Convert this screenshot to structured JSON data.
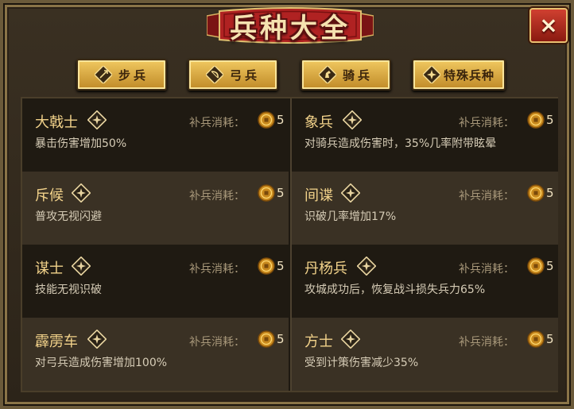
{
  "title": "兵种大全",
  "close_icon": "×",
  "tabs": [
    {
      "label": "步兵",
      "icon": "spear-icon"
    },
    {
      "label": "弓兵",
      "icon": "bow-icon"
    },
    {
      "label": "骑兵",
      "icon": "horse-icon"
    },
    {
      "label": "特殊兵种",
      "icon": "star-icon"
    }
  ],
  "cost_label": "补兵消耗：",
  "units": [
    {
      "name": "大戟士",
      "cost": "5",
      "desc": "暴击伤害增加50%"
    },
    {
      "name": "象兵",
      "cost": "5",
      "desc": "对骑兵造成伤害时，35%几率附带眩晕"
    },
    {
      "name": "斥候",
      "cost": "5",
      "desc": "普攻无视闪避"
    },
    {
      "name": "间谍",
      "cost": "5",
      "desc": "识破几率增加17%"
    },
    {
      "name": "谋士",
      "cost": "5",
      "desc": "技能无视识破"
    },
    {
      "name": "丹杨兵",
      "cost": "5",
      "desc": "攻城成功后，恢复战斗损失兵力65%"
    },
    {
      "name": "霹雳车",
      "cost": "5",
      "desc": "对弓兵造成伤害增加100%"
    },
    {
      "name": "方士",
      "cost": "5",
      "desc": "受到计策伤害减少35%"
    }
  ],
  "colors": {
    "gold": "#f0c860",
    "banner_red": "#a82020",
    "name": "#f2d28a"
  }
}
